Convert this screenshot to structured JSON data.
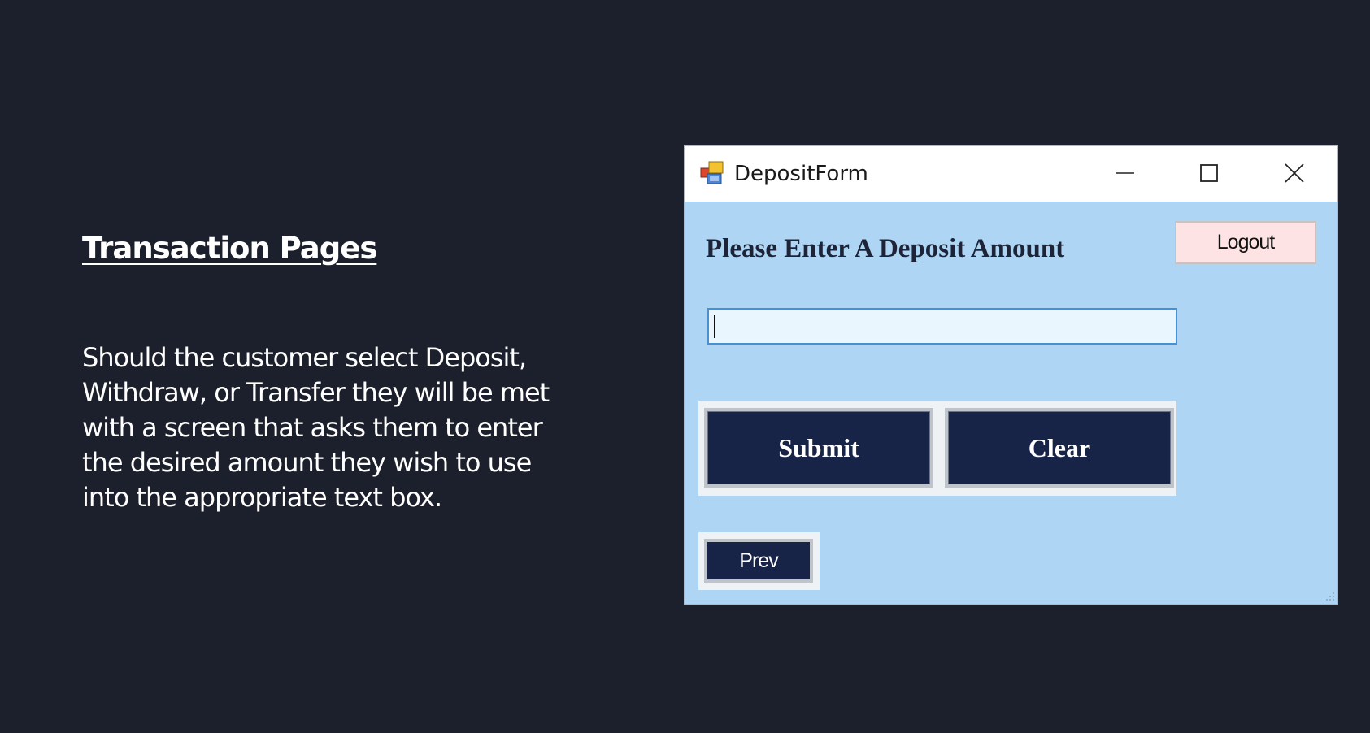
{
  "slide": {
    "title": "Transaction Pages",
    "body_lines": [
      "Should the customer select Deposit,",
      "Withdraw, or Transfer they will be met",
      "with a screen that asks them to enter",
      "the desired amount they wish to use",
      "into the appropriate text box."
    ]
  },
  "window": {
    "title": "DepositForm",
    "icon": "app-icon",
    "controls": [
      "minimize-icon",
      "maximize-icon",
      "close-icon"
    ]
  },
  "form": {
    "prompt": "Please Enter A Deposit Amount",
    "logout_label": "Logout",
    "amount_value": "",
    "submit_label": "Submit",
    "clear_label": "Clear",
    "prev_label": "Prev"
  },
  "colors": {
    "slide_background": "#1c202c",
    "form_background": "#aed6f4",
    "button_navy": "#172447",
    "logout_background": "#fde3e3",
    "input_border": "#4a8fd2"
  }
}
